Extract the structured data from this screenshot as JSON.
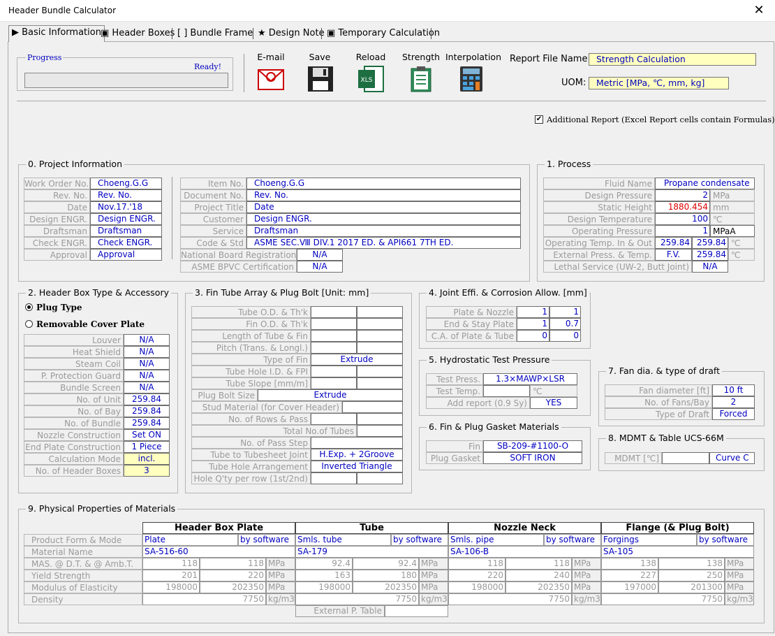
{
  "window": {
    "title": "Header Bundle Calculator",
    "close": "✕"
  },
  "tabs": [
    {
      "label": "▶ Basic Information"
    },
    {
      "label": "▣ Header Boxes"
    },
    {
      "label": "[ ] Bundle Frame"
    },
    {
      "label": "★ Design Note"
    },
    {
      "label": "▣ Temporary Calculation"
    }
  ],
  "progress": {
    "label": "Progress",
    "status": "Ready!"
  },
  "toolbar": {
    "email": "E-mail",
    "save": "Save",
    "reload": "Reload",
    "strength": "Strength",
    "interpolation": "Interpolation",
    "xls_text": "XLS"
  },
  "report": {
    "file_label": "Report File Name:",
    "file_value": "Strength Calculation",
    "uom_label": "UOM:",
    "uom_value": "Metric [MPa, ℃, mm, kg]",
    "additional": "Additional Report (Excel Report cells contain Formulas)"
  },
  "project": {
    "title": "0. Project Information",
    "left": [
      [
        "Work Order No.",
        "Choeng.G.G"
      ],
      [
        "Rev. No.",
        "Rev. No."
      ],
      [
        "Date",
        "Nov.17.'18"
      ],
      [
        "Design ENGR.",
        "Design ENGR."
      ],
      [
        "Draftsman",
        "Draftsman"
      ],
      [
        "Check ENGR.",
        "Check ENGR."
      ],
      [
        "Approval",
        "Approval"
      ]
    ],
    "right": [
      [
        "Item No.",
        "Choeng.G.G"
      ],
      [
        "Document No.",
        "Rev. No."
      ],
      [
        "Project Title",
        "Date"
      ],
      [
        "Customer",
        "Design ENGR."
      ],
      [
        "Service",
        "Draftsman"
      ],
      [
        "Code & Std",
        "ASME SEC.Ⅷ DIV.1 2017 ED. & API661 7TH ED."
      ]
    ],
    "nbr": [
      "National Board Registration",
      "N/A"
    ],
    "bpvc": [
      "ASME BPVC Certification",
      "N/A"
    ]
  },
  "process": {
    "title": "1. Process",
    "fluid": [
      "Fluid Name",
      "Propane condensate"
    ],
    "rows": [
      [
        "Design Pressure",
        "2",
        "MPa"
      ],
      [
        "Static Height",
        "1880.454",
        "mm"
      ],
      [
        "Design Temperature",
        "100",
        "℃"
      ],
      [
        "Operating Pressure",
        "1",
        "MPaA"
      ]
    ],
    "optemp": [
      "Operating Temp. In & Out",
      "259.84",
      "259.84",
      "℃"
    ],
    "extp": [
      "External Press. & Temp.",
      "F.V.",
      "259.84",
      "℃"
    ],
    "lethal": [
      "Lethal Service (UW-2, Butt Joint)",
      "N/A"
    ]
  },
  "headerbox": {
    "title": "2. Header Box Type & Accessory",
    "opt1": "Plug Type",
    "opt2": "Removable Cover Plate",
    "rows": [
      [
        "Louver",
        "N/A"
      ],
      [
        "Heat Shield",
        "N/A"
      ],
      [
        "Steam Coil",
        "N/A"
      ],
      [
        "P. Protection Guard",
        "N/A"
      ],
      [
        "Bundle Screen",
        "N/A"
      ],
      [
        "No. of Unit",
        "259.84"
      ],
      [
        "No. of Bay",
        "259.84"
      ],
      [
        "No. of Bundle",
        "259.84"
      ],
      [
        "Nozzle Construction",
        "Set ON"
      ],
      [
        "End Plate Construction",
        "1 Piece"
      ],
      [
        "Calculation Mode",
        "incl."
      ],
      [
        "No. of Header Boxes",
        "3"
      ]
    ]
  },
  "fintube": {
    "title": "3. Fin Tube Array & Plug Bolt [Unit: mm]",
    "r1": [
      "Tube O.D. & Th'k",
      "Fin O.D. & Th'k",
      "Length of Tube & Fin",
      "Pitch (Trans. & Longl.)"
    ],
    "typefin": [
      "Type of Fin",
      "Extrude"
    ],
    "r2": [
      "Tube Hole I.D. & FPI",
      "Tube Slope [mm/m]"
    ],
    "plugbolt": [
      "Plug Bolt Size",
      "Extrude"
    ],
    "stud": "Stud Material (for Cover Header)",
    "rows": "No. of Rows & Pass",
    "total": "Total No.of Tubes",
    "passstep": "No. of Pass Step",
    "joint": [
      "Tube to Tubesheet Joint",
      "H.Exp. + 2Groove"
    ],
    "arrange": [
      "Tube Hole Arrangement",
      "Inverted Triangle"
    ],
    "holeqty": "Hole Q'ty per row (1st/2nd)"
  },
  "joint": {
    "title": "4. Joint Effi. & Corrosion Allow. [mm]",
    "rows": [
      [
        "Plate & Nozzle",
        "1",
        "1"
      ],
      [
        "End & Stay Plate",
        "1",
        "0.7"
      ],
      [
        "C.A. of Plate & Tube",
        "0",
        "0"
      ]
    ]
  },
  "hydro": {
    "title": "5. Hydrostatic Test Pressure",
    "press": [
      "Test Press.",
      "1.3×MAWP×LSR"
    ],
    "temp": [
      "Test Temp.",
      "℃"
    ],
    "add": [
      "Add report (0.9 Sy)",
      "YES"
    ]
  },
  "gasket": {
    "title": "6. Fin & Plug Gasket Materials",
    "rows": [
      [
        "Fin",
        "SB-209-#1100-O"
      ],
      [
        "Plug Gasket",
        "SOFT IRON"
      ]
    ]
  },
  "fan": {
    "title": "7. Fan dia. & type of draft",
    "rows": [
      [
        "Fan diameter [ft]",
        "10 ft"
      ],
      [
        "No. of Fans/Bay",
        "2"
      ],
      [
        "Type of Draft",
        "Forced"
      ]
    ]
  },
  "mdmt": {
    "title": "8. MDMT & Table UCS-66M",
    "label": "MDMT [℃]",
    "curve": "Curve C"
  },
  "physical": {
    "title": "9. Physical Properties of Materials",
    "headers": [
      "Header Box Plate",
      "Tube",
      "Nozzle Neck",
      "Flange (& Plug Bolt)"
    ],
    "rowlabels": [
      "Product Form & Mode",
      "Material Name",
      "MAS. @ D.T. & @ Amb.T.",
      "Yield Strength",
      "Modulus of Elasticity",
      "Density"
    ],
    "form": [
      [
        "Plate",
        "by software"
      ],
      [
        "Smls. tube",
        "by software"
      ],
      [
        "Smls. pipe",
        "by software"
      ],
      [
        "Forgings",
        "by software"
      ]
    ],
    "material": [
      "SA-516-60",
      "SA-179",
      "SA-106-B",
      "SA-105"
    ],
    "mas": [
      [
        "118",
        "118"
      ],
      [
        "92.4",
        "92.4"
      ],
      [
        "118",
        "118"
      ],
      [
        "138",
        "138"
      ]
    ],
    "yield": [
      [
        "201",
        "220"
      ],
      [
        "163",
        "180"
      ],
      [
        "220",
        "240"
      ],
      [
        "227",
        "250"
      ]
    ],
    "modulus": [
      [
        "198000",
        "202350"
      ],
      [
        "198000",
        "202350"
      ],
      [
        "198000",
        "202350"
      ],
      [
        "197000",
        "201300"
      ]
    ],
    "density": [
      "7750",
      "7750",
      "7750",
      "7750"
    ],
    "unit_mpa": "MPa",
    "unit_kg": "kg/m3",
    "extp": "External P. Table"
  }
}
